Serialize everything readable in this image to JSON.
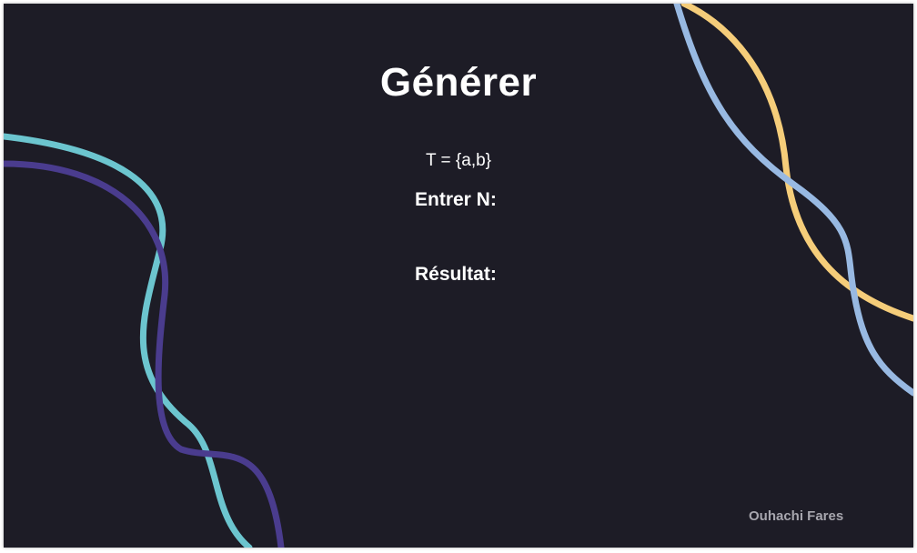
{
  "window": {
    "title": "Générer"
  },
  "content": {
    "alphabet": "T = {a,b}",
    "n_label": "Entrer N:",
    "n_value": "",
    "result_label": "Résultat:",
    "result_value": ""
  },
  "footer": {
    "author": "Ouhachi Fares"
  },
  "colors": {
    "background": "#1d1c26",
    "teal": "#6cc5cf",
    "indigo": "#4a3c8e",
    "yellow": "#f5cd7a",
    "light_blue": "#98b9e2"
  }
}
